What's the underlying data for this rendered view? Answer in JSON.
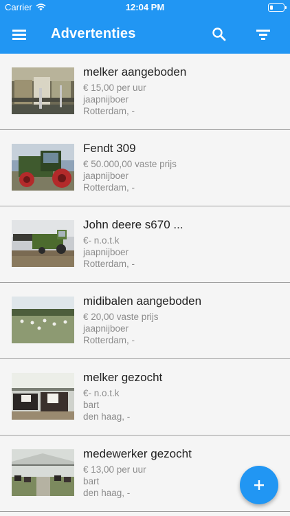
{
  "status": {
    "carrier": "Carrier",
    "time": "12:04 PM"
  },
  "header": {
    "title": "Advertenties",
    "menu_icon": "menu-icon",
    "search_icon": "search-icon",
    "filter_icon": "filter-icon"
  },
  "listings": [
    {
      "title": "melker aangeboden",
      "price": "€ 15,00 per uur",
      "seller": "jaapnijboer",
      "location": "Rotterdam, -"
    },
    {
      "title": "Fendt 309",
      "price": "€ 50.000,00 vaste prijs",
      "seller": "jaapnijboer",
      "location": "Rotterdam, -"
    },
    {
      "title": "John deere s670 ...",
      "price": "€- n.o.t.k",
      "seller": "jaapnijboer",
      "location": "Rotterdam, -"
    },
    {
      "title": "midibalen aangeboden",
      "price": "€ 20,00 vaste prijs",
      "seller": "jaapnijboer",
      "location": "Rotterdam, -"
    },
    {
      "title": "melker gezocht",
      "price": "€- n.o.t.k",
      "seller": "bart",
      "location": "den haag, -"
    },
    {
      "title": "medewerker gezocht",
      "price": "€ 13,00 per uur",
      "seller": "bart",
      "location": "den haag, -"
    }
  ],
  "fab": {
    "icon": "plus-icon"
  },
  "colors": {
    "primary": "#2196f3",
    "text_primary": "#212121",
    "text_secondary": "#8c8c8c",
    "divider": "#9e9e9e"
  }
}
